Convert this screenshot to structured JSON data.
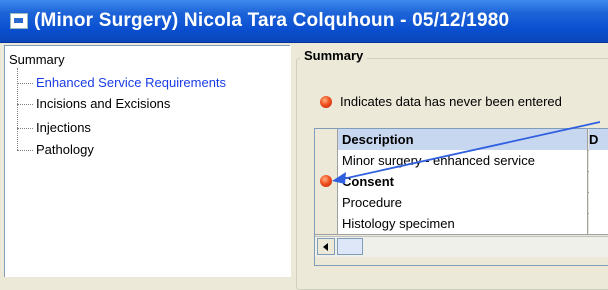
{
  "window": {
    "title": "(Minor Surgery) Nicola Tara Colquhoun - 05/12/1980"
  },
  "tree": {
    "root": "Summary",
    "items": [
      {
        "label": "Enhanced Service Requirements",
        "selected": true
      },
      {
        "label": "Incisions and Excisions",
        "selected": false
      },
      {
        "label": "Injections",
        "selected": false
      },
      {
        "label": "Pathology",
        "selected": false
      }
    ]
  },
  "summary": {
    "group_title": "Summary",
    "legend_text": "Indicates data has never been entered",
    "columns": [
      "Description",
      "D"
    ],
    "rows": [
      {
        "description": "Minor surgery - enhanced service",
        "bold": false,
        "no_data": false
      },
      {
        "description": "Consent",
        "bold": true,
        "no_data": true
      },
      {
        "description": "Procedure",
        "bold": false,
        "no_data": false
      },
      {
        "description": "Histology specimen",
        "bold": false,
        "no_data": false
      }
    ]
  },
  "colors": {
    "selected_link": "#1A3CE6",
    "header_bg": "#C7D7F0",
    "no_data_dot": "#E84A1A",
    "annotation_arrow": "#3060E0"
  }
}
